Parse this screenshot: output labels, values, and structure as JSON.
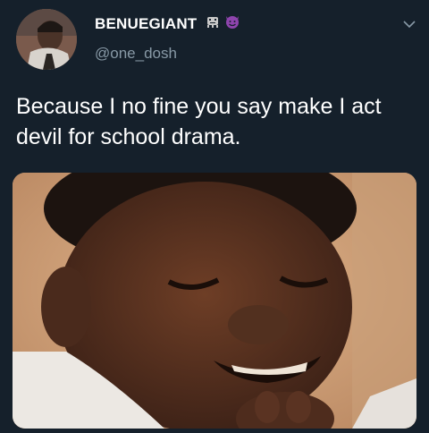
{
  "tweet": {
    "display_name": "BENUEGIANT",
    "handle": "@one_dosh",
    "badges": [
      "alien-monster-icon",
      "smiling-devil-icon"
    ],
    "text": "Because I no fine you say make I act devil for school drama.",
    "menu_icon": "chevron-down-icon",
    "media": {
      "kind": "photo",
      "description_icon": "photo-laughing-boy"
    }
  },
  "colors": {
    "background": "#15202b",
    "text_primary": "#ffffff",
    "text_secondary": "#8899a6",
    "badge_purple": "#8e44ad"
  }
}
